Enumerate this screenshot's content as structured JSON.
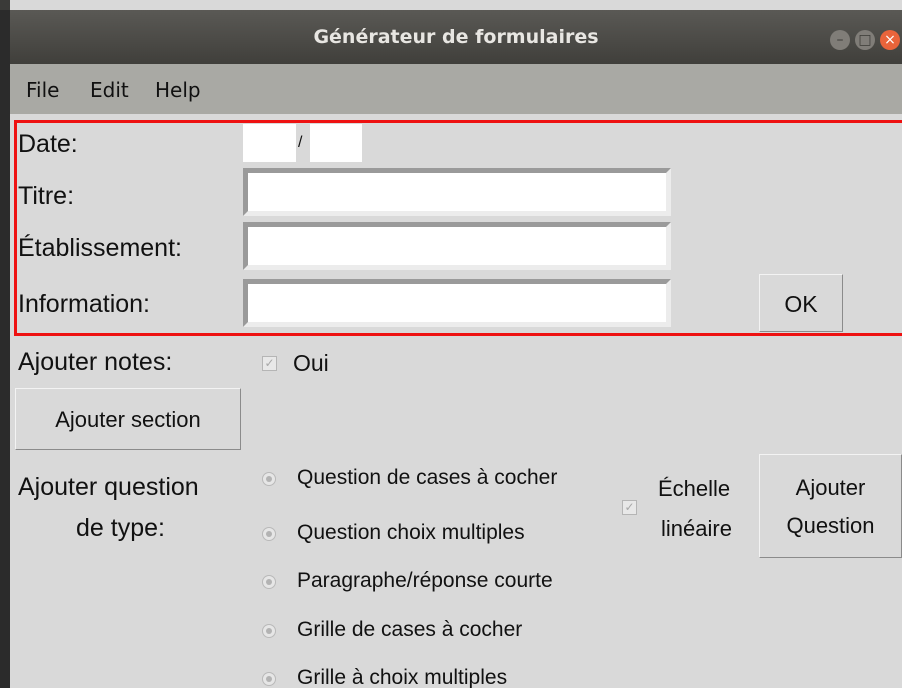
{
  "window": {
    "title": "Générateur de formulaires"
  },
  "menu": [
    "File",
    "Edit",
    "Help"
  ],
  "form": {
    "date_label": "Date:",
    "date_sep": "/",
    "titre_label": "Titre:",
    "etablissement_label": "Établissement:",
    "information_label": "Information:",
    "ok_label": "OK"
  },
  "notes": {
    "label": "Ajouter notes:",
    "checkbox_label": "Oui",
    "checked": true
  },
  "section_button": "Ajouter section",
  "question": {
    "label_line1": "Ajouter question",
    "label_line2": "de type:",
    "options": [
      "Question de cases à cocher",
      "Question  choix multiples",
      "Paragraphe/réponse courte",
      "Grille de cases à cocher",
      "Grille à choix multiples"
    ],
    "scale_line1": "Échelle",
    "scale_line2": "linéaire",
    "add_line1": "Ajouter",
    "add_line2": "Question"
  }
}
